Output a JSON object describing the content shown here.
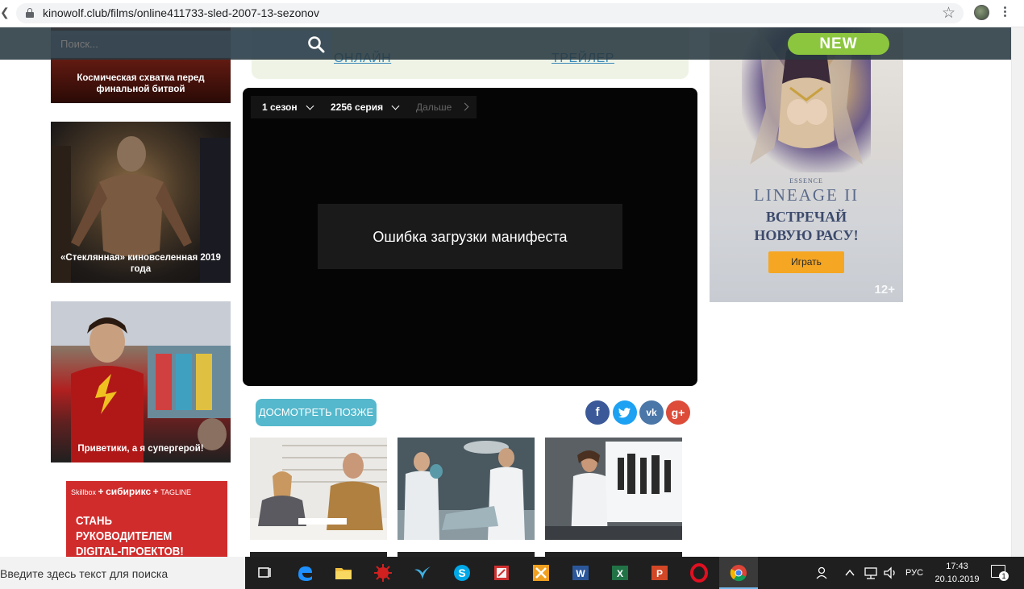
{
  "browser": {
    "url": "kinowolf.club/films/online411733-sled-2007-13-sezonov"
  },
  "site": {
    "search_placeholder": "Поиск...",
    "new_label": "NEW",
    "tabs": {
      "online": "ОНЛАЙН",
      "trailer": "ТРЕЙЛЕР"
    }
  },
  "sidebar": {
    "cards": [
      {
        "title": "Космическая схватка перед финальной битвой"
      },
      {
        "title": "«Стеклянная» киновселенная 2019 года"
      },
      {
        "title": "Приветики, а я супергерой!"
      }
    ],
    "ad": {
      "brand_1": "Skillbox",
      "plus_1": "+",
      "brand_2": "сибирикс",
      "plus_2": "+",
      "brand_3": "TAGLINE",
      "line_1": "СТАНЬ РУКОВОДИТЕЛЕМ",
      "line_2": "DIGITAL-ПРОЕКТОВ!"
    }
  },
  "player": {
    "season": "1 сезон",
    "episode": "2256 серия",
    "next": "Дальше",
    "error": "Ошибка загрузки манифеста"
  },
  "actions": {
    "watch_later": "ДОСМОТРЕТЬ ПОЗЖЕ",
    "social": {
      "facebook": "f",
      "vk": "vk",
      "google_plus": "g+"
    }
  },
  "right_ad": {
    "essence": "ESSENCE",
    "logo": "LINEAGE II",
    "headline_1": "ВСТРЕЧАЙ",
    "headline_2": "НОВУЮ РАСУ!",
    "play": "Играть",
    "age": "12+"
  },
  "taskbar": {
    "search_text": "Введите здесь текст для поиска",
    "language": "РУС",
    "time": "17:43",
    "date": "20.10.2019",
    "notifications": "1"
  },
  "colors": {
    "site_bar": "#283840",
    "new_badge": "#8cc63f",
    "watch_later": "#55b8cc",
    "ad_button": "#f5a623"
  }
}
